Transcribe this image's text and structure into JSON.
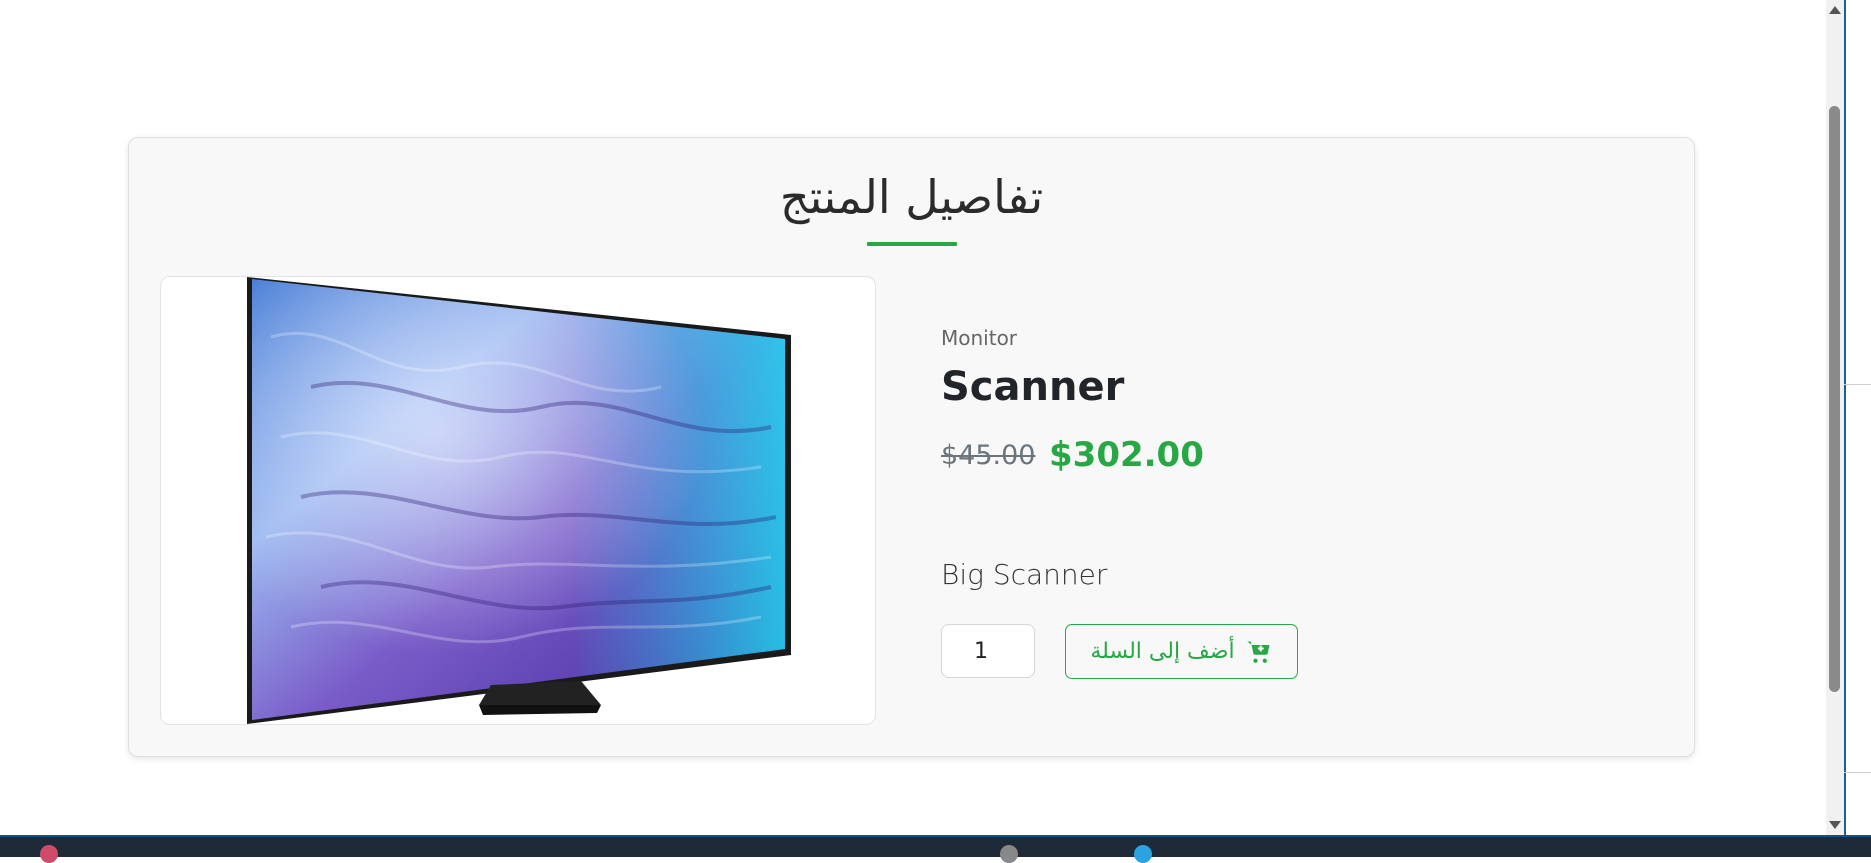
{
  "page": {
    "section_title": "تفاصيل المنتج"
  },
  "product": {
    "category": "Monitor",
    "name": "Scanner",
    "old_price": "$45.00",
    "new_price": "$302.00",
    "description": "Big Scanner",
    "quantity": "1",
    "add_to_cart_label": "أضف إلى السلة",
    "image_icon": "tv-monitor-image"
  },
  "colors": {
    "accent": "#28a745",
    "card_bg": "#f8f8f8",
    "taskbar": "#1e2a38"
  }
}
